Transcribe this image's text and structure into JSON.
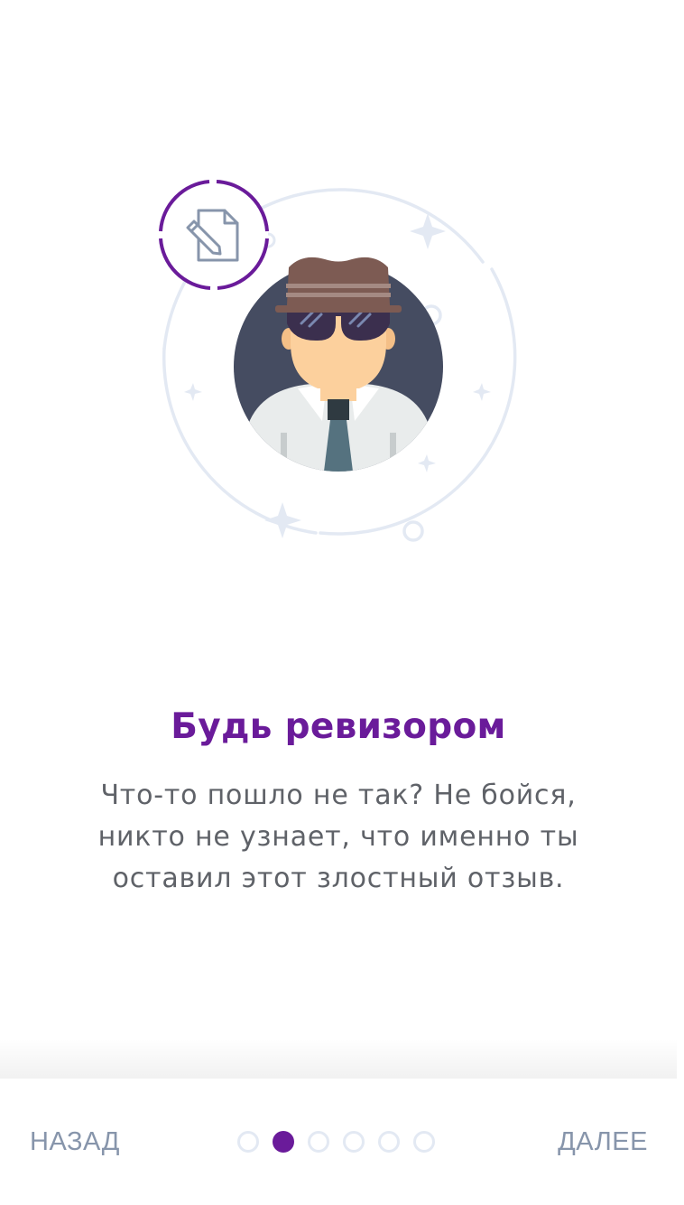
{
  "onboarding": {
    "title": "Будь ревизором",
    "description": "Что-то пошло не так? Не бойся, никто не узнает, что именно ты оставил этот злостный отзыв.",
    "illustration_icons": [
      "detective-avatar",
      "edit-document-icon"
    ]
  },
  "navigation": {
    "back_label": "НАЗАД",
    "next_label": "ДАЛЕЕ",
    "page_count": 6,
    "current_page": 2
  },
  "colors": {
    "accent": "#6a1b9a",
    "nav_text": "#8795ab",
    "body_text": "#5f6268",
    "dot_inactive": "#e3e9f3",
    "ring": "#e3e9f3"
  }
}
